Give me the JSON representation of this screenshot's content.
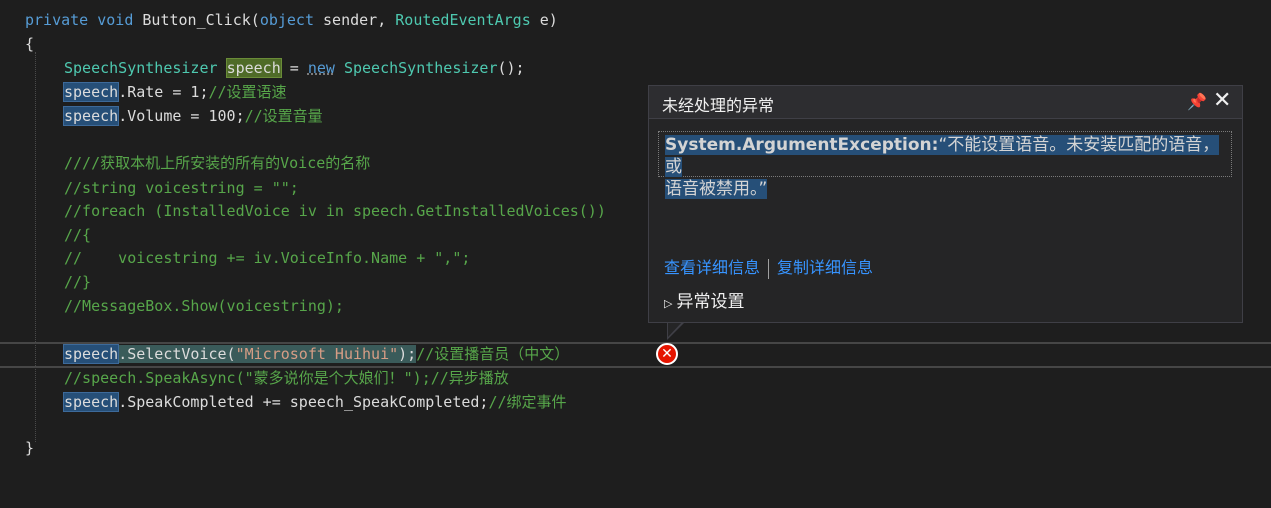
{
  "editor": {
    "code": {
      "l1": {
        "kw1": "private",
        "kw2": "void",
        "name": " Button_Click(",
        "kw3": "object",
        "p1": " sender, ",
        "type": "RoutedEventArgs",
        "p2": " e)"
      },
      "l2": {
        "text": "{"
      },
      "l3": {
        "type": "SpeechSynthesizer",
        "var": "speech",
        "eq": " = ",
        "kw": "new",
        "type2": "SpeechSynthesizer",
        "end": "();"
      },
      "l4": {
        "var": "speech",
        "text": ".Rate = 1;",
        "comment": "//设置语速"
      },
      "l5": {
        "var": "speech",
        "text": ".Volume = 100;",
        "comment": "//设置音量"
      },
      "l6": {
        "comment": "////获取本机上所安装的所有的Voice的名称"
      },
      "l7": {
        "comment": "//string voicestring = \"\";"
      },
      "l8": {
        "comment": "//foreach (InstalledVoice iv in speech.GetInstalledVoices())"
      },
      "l9": {
        "comment": "//{"
      },
      "l10": {
        "comment": "//    voicestring += iv.VoiceInfo.Name + \",\";"
      },
      "l11": {
        "comment": "//}"
      },
      "l12": {
        "comment": "//MessageBox.Show(voicestring);"
      },
      "l13": {
        "var": "speech",
        "text": ".SelectVoice(",
        "str": "\"Microsoft Huihui\"",
        "end": ");",
        "comment": "//设置播音员（中文）"
      },
      "l14": {
        "comment": "//speech.SpeakAsync(\"蒙多说你是个大娘们！\");//异步播放"
      },
      "l15": {
        "var": "speech",
        "text": ".SpeakCompleted += speech_SpeakCompleted;",
        "comment": "//绑定事件"
      },
      "l16": {
        "text": "}"
      }
    }
  },
  "popup": {
    "title": "未经处理的异常",
    "pin_icon": "pin-icon",
    "close_icon": "close-icon",
    "exception_type": "System.ArgumentException:",
    "exception_message_line1": "“不能设置语音。未安装匹配的语音，或",
    "exception_message_line2": "语音被禁用。”",
    "link_view_details": "查看详细信息",
    "link_copy_details": "复制详细信息",
    "settings_label": "异常设置"
  },
  "colors": {
    "background": "#1e1e1e",
    "keyword": "#569cd6",
    "type": "#4ec9b0",
    "comment": "#57a64a",
    "string": "#d69d85",
    "link": "#3794ff",
    "error": "#e51400"
  }
}
